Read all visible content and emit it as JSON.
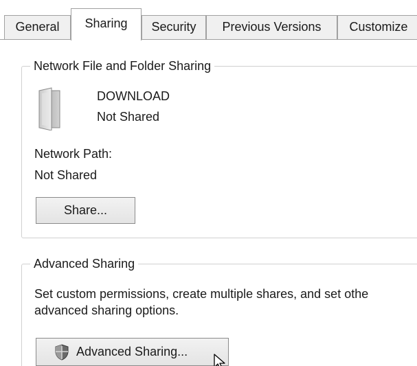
{
  "tabs": [
    {
      "label": "General",
      "active": false
    },
    {
      "label": "Sharing",
      "active": true
    },
    {
      "label": "Security",
      "active": false
    },
    {
      "label": "Previous Versions",
      "active": false
    },
    {
      "label": "Customize",
      "active": false
    }
  ],
  "network_group": {
    "legend": "Network File and Folder Sharing",
    "folder_icon": "folder-icon",
    "folder_name": "DOWNLOAD",
    "folder_status": "Not Shared",
    "path_label": "Network Path:",
    "path_value": "Not Shared",
    "share_button": "Share..."
  },
  "advanced_group": {
    "legend": "Advanced Sharing",
    "description_line1": "Set custom permissions, create multiple shares, and set othe",
    "description_line2": "advanced sharing options.",
    "shield_icon": "shield-icon",
    "button_label": "Advanced Sharing..."
  },
  "colors": {
    "tab_border": "#a0a0a0",
    "tab_bg": "#f0f0f0",
    "group_border": "#d0d0d0",
    "button_border": "#8a8a8a"
  }
}
